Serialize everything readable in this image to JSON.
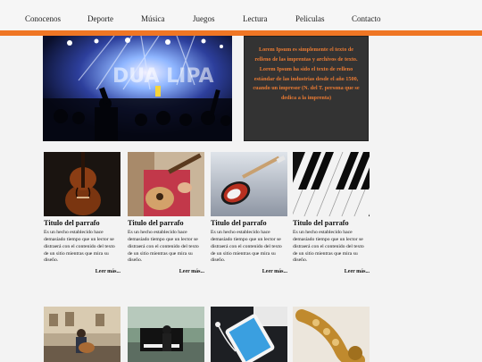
{
  "nav": {
    "items": [
      "Conocenos",
      "Deporte",
      "Música",
      "Juegos",
      "Lectura",
      "Peliculas",
      "Contacto"
    ]
  },
  "hero": {
    "banner_text": "DUA LIPA"
  },
  "intro": {
    "text": "Lorem Ipsum es simplemente el texto de relleno de las imprentas y archivos de texto. Lorem Ipsum ha sido el texto de relleno estándar de las industrias desde el año 1500, cuando un impresor (N. del T. persona que se dedica a la imprenta)"
  },
  "cards": [
    {
      "image": "cello-image",
      "title": "Titulo del parrafo",
      "body": "Es un hecho establecido hace demasiado tiempo que un lector se distraerá con el contenido del texto de un sitio mientras que mira su diseño.",
      "more": "Leer más..."
    },
    {
      "image": "ukulele-image",
      "title": "Titulo del parrafo",
      "body": "Es un hecho establecido hace demasiado tiempo que un lector se distraerá con el contenido del texto de un sitio mientras que mira su diseño.",
      "more": "Leer más..."
    },
    {
      "image": "electric-guitar-image",
      "title": "Titulo del parrafo",
      "body": "Es un hecho establecido hace demasiado tiempo que un lector se distraerá con el contenido del texto de un sitio mientras que mira su diseño.",
      "more": "Leer más..."
    },
    {
      "image": "piano-keys-image",
      "title": "Titulo del parrafo",
      "body": "Es un hecho establecido hace demasiado tiempo que un lector se distraerá con el contenido del texto de un sitio mientras que mira su diseño.",
      "more": "Leer más..."
    }
  ],
  "second_row_images": [
    "street-guitarist-image",
    "street-piano-image",
    "phone-earbuds-image",
    "saxophone-image"
  ],
  "colors": {
    "accent": "#ef7624",
    "infobox_bg": "#333333",
    "infobox_text": "#e97a33"
  }
}
